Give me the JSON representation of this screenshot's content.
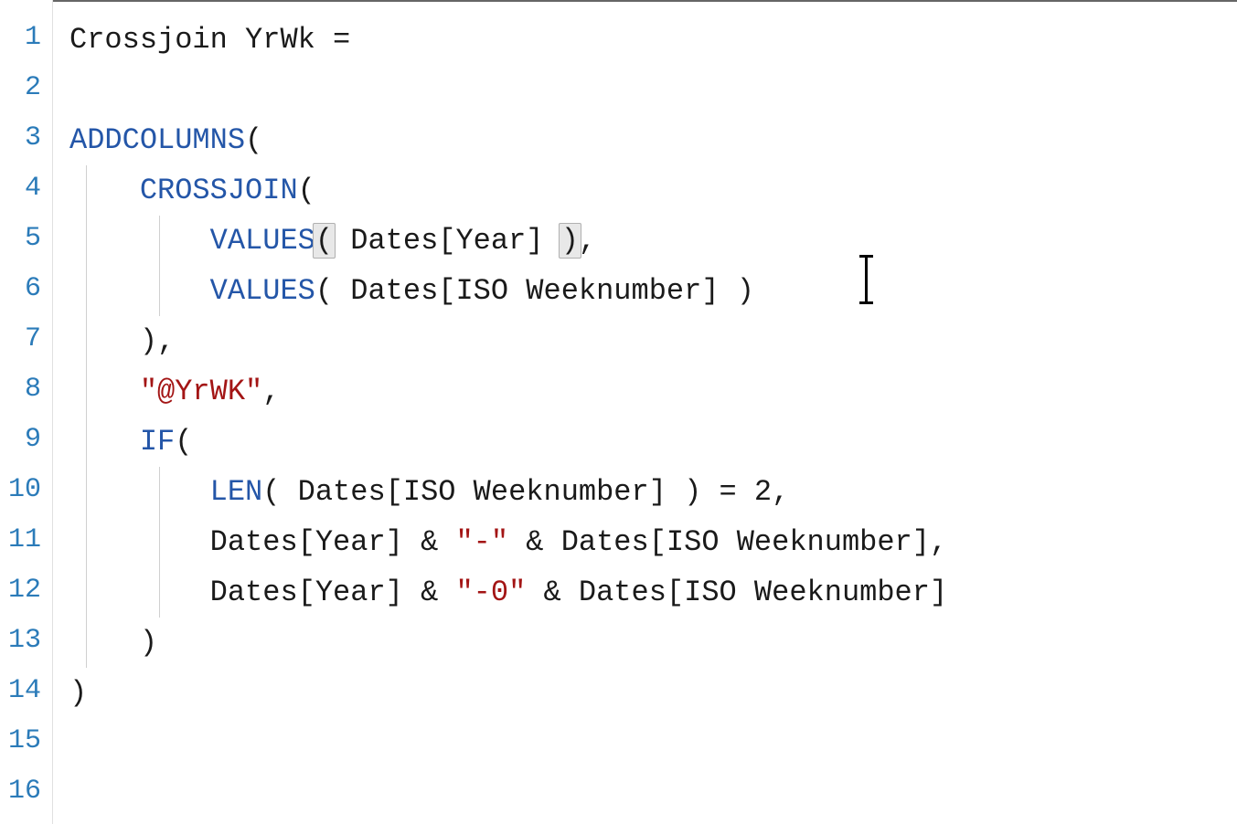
{
  "lineNumbers": [
    "1",
    "2",
    "3",
    "4",
    "5",
    "6",
    "7",
    "8",
    "9",
    "10",
    "11",
    "12",
    "13",
    "14",
    "15",
    "16"
  ],
  "code": {
    "l1": {
      "measure": "Crossjoin YrWk ="
    },
    "l2": {},
    "l3": {
      "func": "ADDCOLUMNS",
      "after": "("
    },
    "l4": {
      "func": "CROSSJOIN",
      "after": "("
    },
    "l5": {
      "func": "VALUES",
      "open": "(",
      "arg": " Dates[Year] ",
      "close": ")",
      "trail": ","
    },
    "l6": {
      "func": "VALUES",
      "rest": "( Dates[ISO Weeknumber] )"
    },
    "l7": {
      "text": "),"
    },
    "l8": {
      "str": "\"@YrWK\"",
      "trail": ","
    },
    "l9": {
      "func": "IF",
      "after": "("
    },
    "l10": {
      "func": "LEN",
      "mid": "( Dates[ISO Weeknumber] ) = ",
      "num": "2",
      "trail": ","
    },
    "l11": {
      "p1": "Dates[Year] & ",
      "s1": "\"-\"",
      "p2": " & Dates[ISO Weeknumber],"
    },
    "l12": {
      "p1": "Dates[Year] & ",
      "s1": "\"-0\"",
      "p2": " & Dates[ISO Weeknumber]"
    },
    "l13": {
      "text": ")"
    },
    "l14": {
      "text": ")"
    }
  }
}
